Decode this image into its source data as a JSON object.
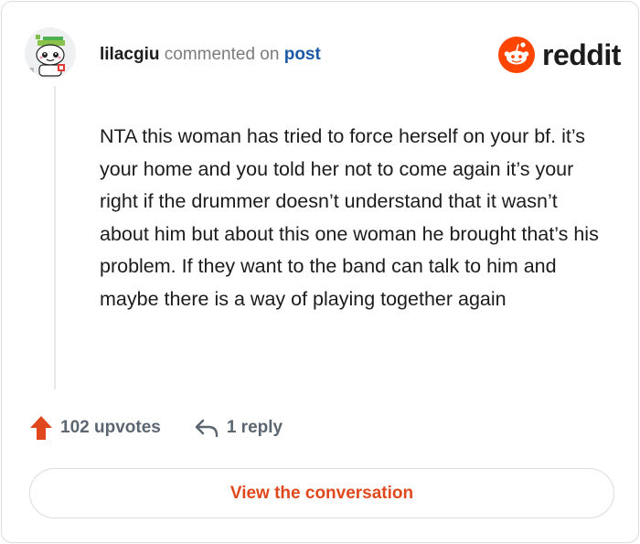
{
  "comment": {
    "username": "lilacgiu",
    "action_text": "commented on",
    "post_link": "post",
    "body": "NTA this woman has tried to force herself on your bf. it’s your home and you told her not to come again it’s your right if the drummer doesn’t understand that it wasn’t about him but about this one woman he brought that’s his problem. If they want to the band can talk to him and maybe there is a way of playing together again"
  },
  "brand": {
    "name": "reddit",
    "color": "#ff4500",
    "icon": "reddit-snoo-icon"
  },
  "actions": {
    "upvotes": "102 upvotes",
    "upvote_icon": "upvote-arrow-icon",
    "upvote_color": "#e0471c",
    "replies": "1 reply",
    "reply_icon": "reply-arrow-icon"
  },
  "cta": {
    "label": "View the conversation"
  }
}
